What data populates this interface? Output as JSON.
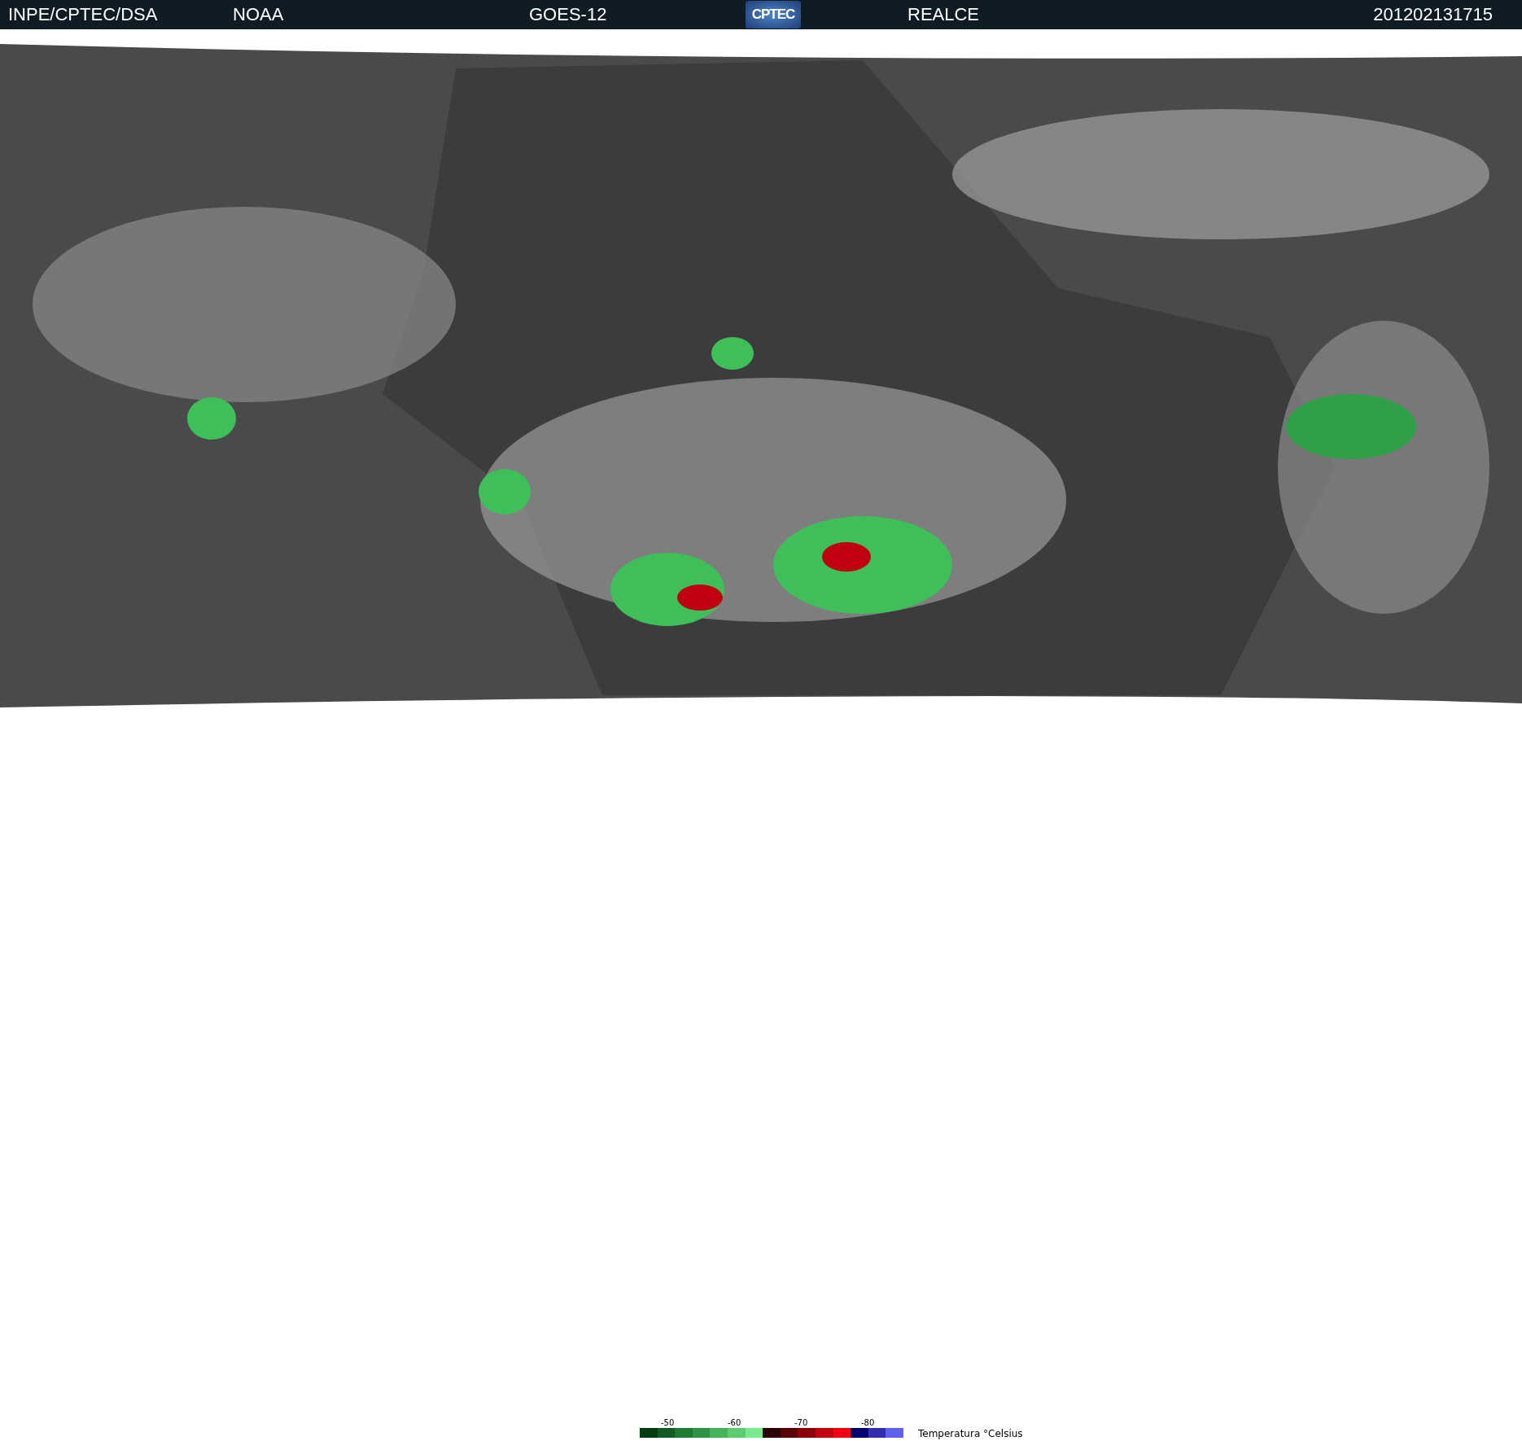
{
  "header": {
    "items": [
      "INPE/CPTEC/DSA",
      "NOAA",
      "GOES-12"
    ],
    "logo": "CPTEC",
    "mode": "REALCE",
    "timestamp": "201202131715"
  },
  "legend": {
    "ticks": [
      "-50",
      "-60",
      "-70",
      "-80"
    ],
    "unit": "Temperatura °Celsius",
    "swatches": [
      {
        "color": "#003d12"
      },
      {
        "color": "#145a24"
      },
      {
        "color": "#1f7a33"
      },
      {
        "color": "#2e9444"
      },
      {
        "color": "#45b35a"
      },
      {
        "color": "#5ccc6e"
      },
      {
        "color": "#7aeb8a"
      },
      {
        "color": "#2a0005"
      },
      {
        "color": "#5c0008"
      },
      {
        "color": "#8c0008"
      },
      {
        "color": "#c00010"
      },
      {
        "color": "#f00012"
      },
      {
        "color": "#000070"
      },
      {
        "color": "#3030b0"
      },
      {
        "color": "#6060f0"
      }
    ]
  }
}
